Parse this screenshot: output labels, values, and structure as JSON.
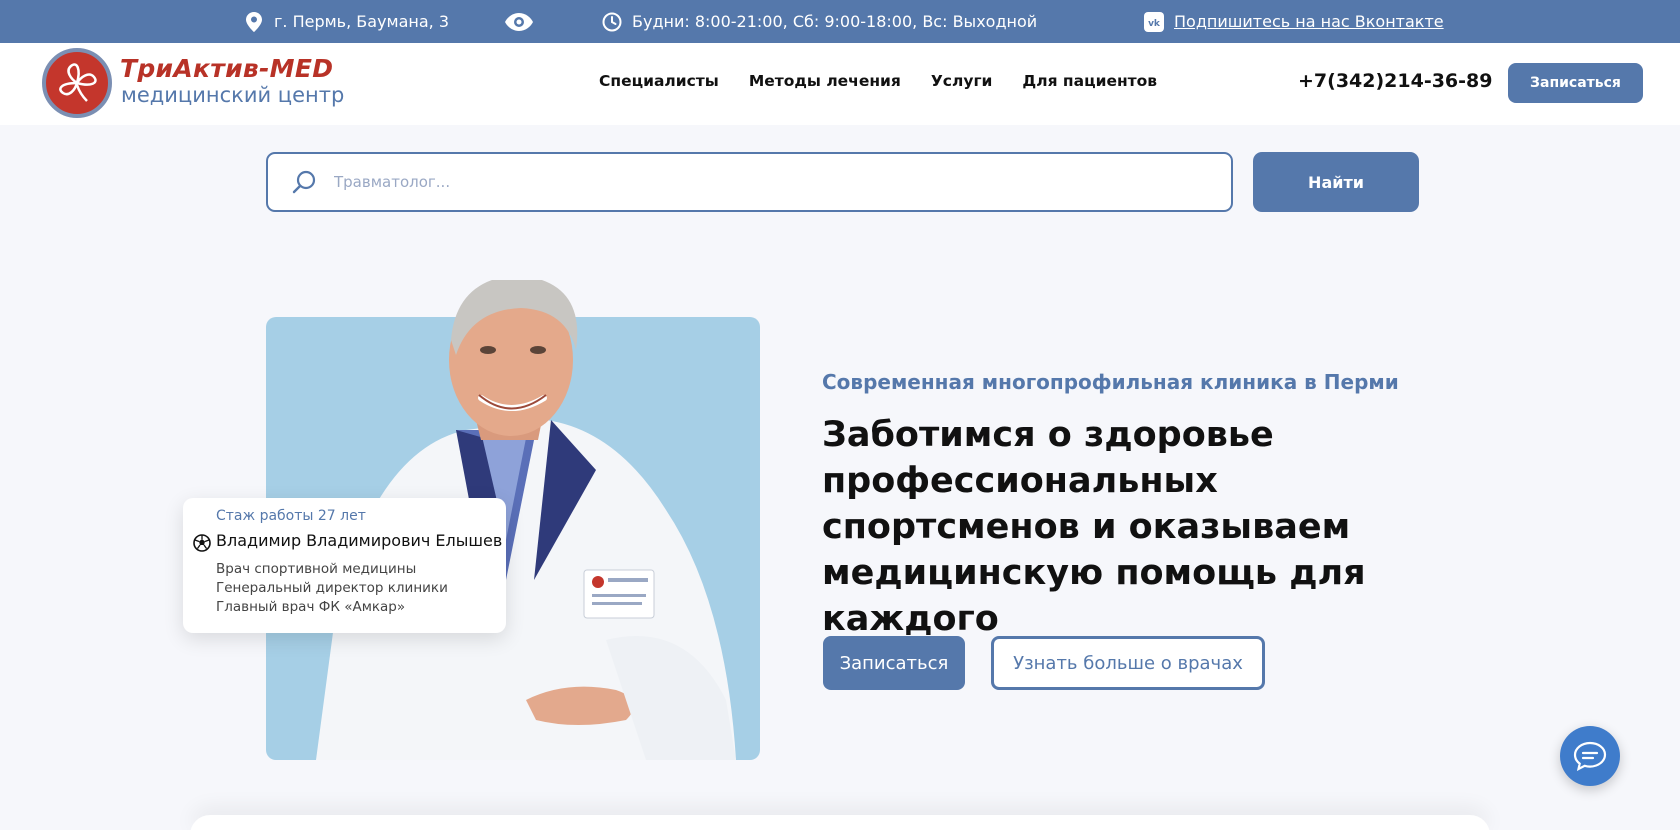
{
  "topbar": {
    "address": "г. Пермь, Баумана, 3",
    "hours": "Будни: 8:00-21:00, Сб: 9:00-18:00, Вс: Выходной",
    "vk_link": "Подпишитесь на нас Вконтакте",
    "icons": [
      "map-pin-icon",
      "eye-icon",
      "clock-icon",
      "vk-icon"
    ]
  },
  "header": {
    "logo_title": "ТриАктив-MED",
    "logo_subtitle": "медицинский центр",
    "nav": [
      "Специалисты",
      "Методы лечения",
      "Услуги",
      "Для пациентов"
    ],
    "phone": "+7(342)214-36-89",
    "signup_label": "Записаться"
  },
  "search": {
    "placeholder": "Травматолог...",
    "button_label": "Найти"
  },
  "hero": {
    "subtitle": "Современная многопрофильная клиника в Перми",
    "headline": "Заботимся о здоровье профессиональных спортсменов и оказываем медицинскую помощь для каждого",
    "primary_button": "Записаться",
    "secondary_button": "Узнать больше о врачах",
    "doctor_card": {
      "experience": "Стаж работы 27 лет",
      "name": "Владимир Владимирович Елышев",
      "roles": [
        "Врач спортивной медицины",
        "Генеральный директор клиники",
        "Главный врач ФК «Амкар»"
      ]
    }
  },
  "colors": {
    "accent": "#5578ab",
    "brand_red": "#b83227",
    "photo_bg": "#a6cfe6",
    "chat": "#3f7ccb"
  }
}
